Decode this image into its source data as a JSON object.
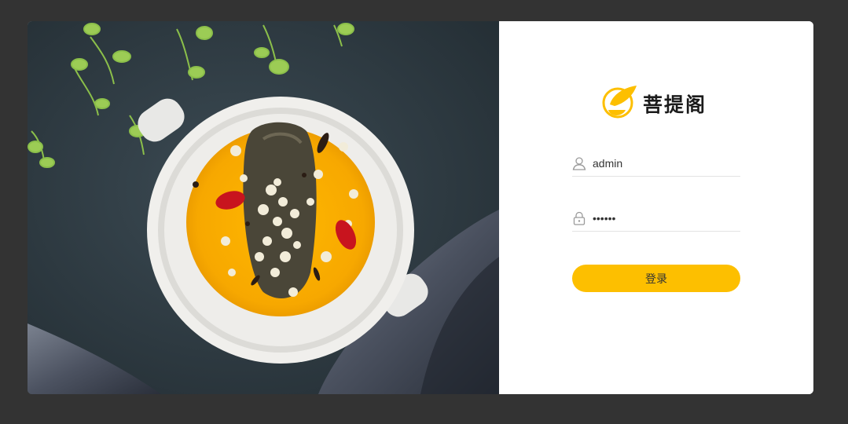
{
  "brand": {
    "name": "菩提阁",
    "logo_icon": "leaf-bowl-logo-icon",
    "accent_color": "#fdbf00"
  },
  "login_form": {
    "username": {
      "icon": "user-icon",
      "value": "admin"
    },
    "password": {
      "icon": "lock-icon",
      "value": "••••••"
    },
    "submit_label": "登录"
  },
  "hero_image": {
    "subject": "food-bowl-photo"
  }
}
